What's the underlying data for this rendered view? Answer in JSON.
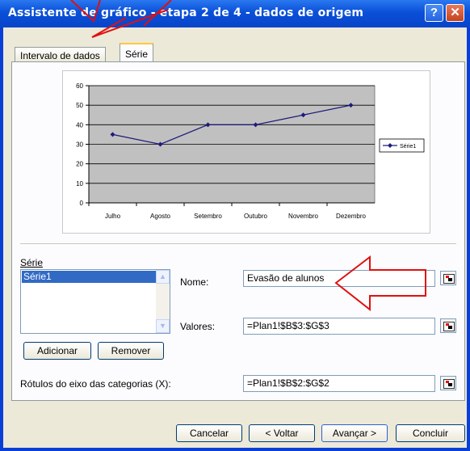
{
  "window": {
    "title": "Assistente de gráfico - etapa 2 de 4 - dados de origem",
    "help_glyph": "?",
    "close_glyph": "✕"
  },
  "tabs": [
    {
      "label": "Intervalo de dados",
      "active": false
    },
    {
      "label": "Série",
      "active": true
    }
  ],
  "chart_data": {
    "type": "line",
    "categories": [
      "Julho",
      "Agosto",
      "Setembro",
      "Outubro",
      "Novembro",
      "Dezembro"
    ],
    "series": [
      {
        "name": "Série1",
        "values": [
          35,
          30,
          40,
          40,
          45,
          50
        ],
        "color": "#1c1c7c"
      }
    ],
    "yticks": [
      "60",
      "50",
      "40",
      "30",
      "20",
      "10",
      "0"
    ],
    "ylim": [
      0,
      60
    ],
    "grid": true,
    "plot_background": "#c0c0c0",
    "legend": "right"
  },
  "serie_section": {
    "label": "Série",
    "items": [
      "Série1"
    ],
    "add_button": "Adicionar",
    "remove_button": "Remover"
  },
  "fields": {
    "nome_label": "Nome:",
    "nome_value": "Evasão de alunos",
    "valores_label": "Valores:",
    "valores_value": "=Plan1!$B$3:$G$3",
    "rotulos_label": "Rótulos do eixo das categorias (X):",
    "rotulos_value": "=Plan1!$B$2:$G$2"
  },
  "buttons": {
    "cancel": "Cancelar",
    "back": "< Voltar",
    "next": "Avançar >",
    "finish": "Concluir"
  },
  "annotation_color": "#e01010"
}
